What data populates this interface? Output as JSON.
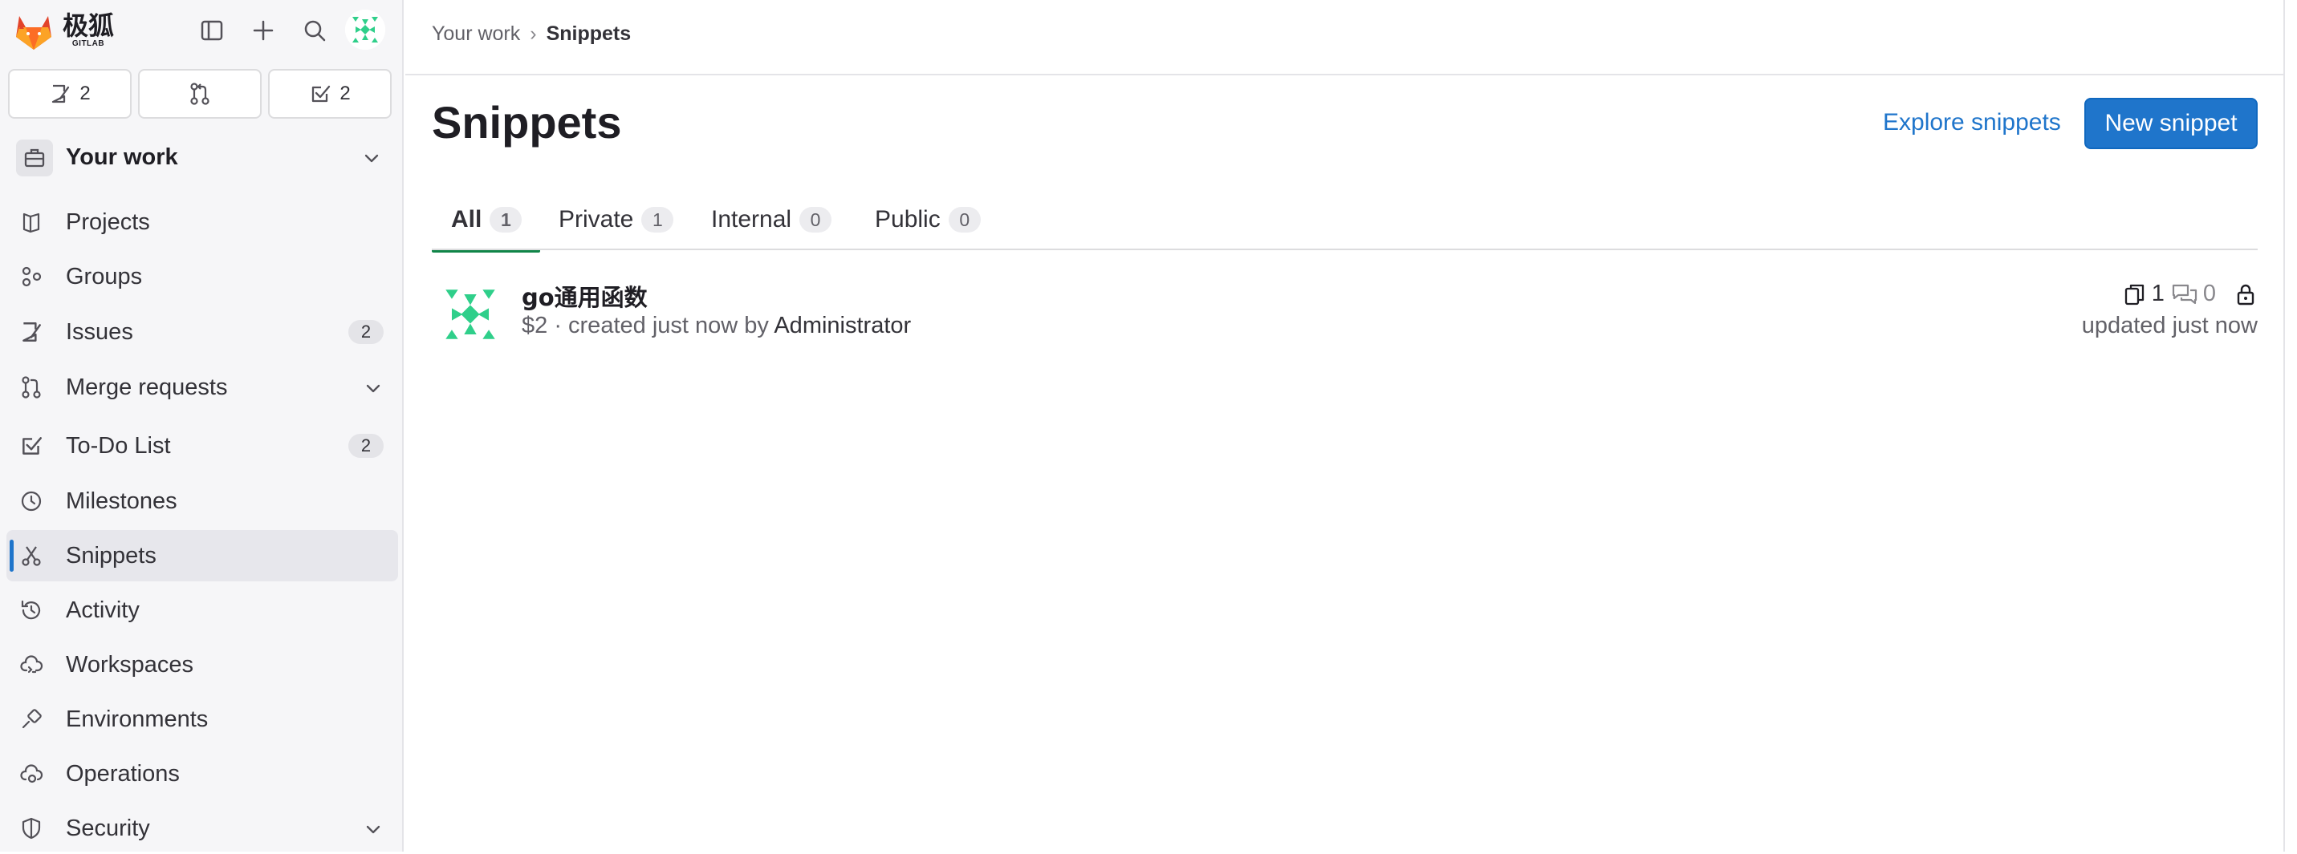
{
  "brand": {
    "name": "极狐",
    "sub": "GITLAB"
  },
  "sidebar_top": {
    "issues_count": "2",
    "todo_count": "2"
  },
  "context": {
    "label": "Your work"
  },
  "nav": {
    "items": [
      {
        "label": "Projects"
      },
      {
        "label": "Groups"
      },
      {
        "label": "Issues",
        "badge": "2"
      },
      {
        "label": "Merge requests"
      },
      {
        "label": "To-Do List",
        "badge": "2"
      },
      {
        "label": "Milestones"
      },
      {
        "label": "Snippets"
      },
      {
        "label": "Activity"
      },
      {
        "label": "Workspaces"
      },
      {
        "label": "Environments"
      },
      {
        "label": "Operations"
      },
      {
        "label": "Security"
      }
    ],
    "active": "Snippets"
  },
  "breadcrumb": {
    "home": "Your work",
    "separator": "›",
    "current": "Snippets"
  },
  "page": {
    "title": "Snippets",
    "explore_label": "Explore snippets",
    "new_label": "New snippet"
  },
  "tabs": [
    {
      "label": "All",
      "count": "1"
    },
    {
      "label": "Private",
      "count": "1"
    },
    {
      "label": "Internal",
      "count": "0"
    },
    {
      "label": "Public",
      "count": "0"
    }
  ],
  "snippet": {
    "title": "go通用函数",
    "meta_prefix": "$2 · created just now by ",
    "author": "Administrator",
    "files_count": "1",
    "comments_count": "0",
    "updated": "updated just now",
    "visibility_icon": "lock-icon"
  },
  "colors": {
    "accent": "#1f75cb",
    "tab_active": "#108548",
    "avatar_green": "#2fcf8a"
  }
}
